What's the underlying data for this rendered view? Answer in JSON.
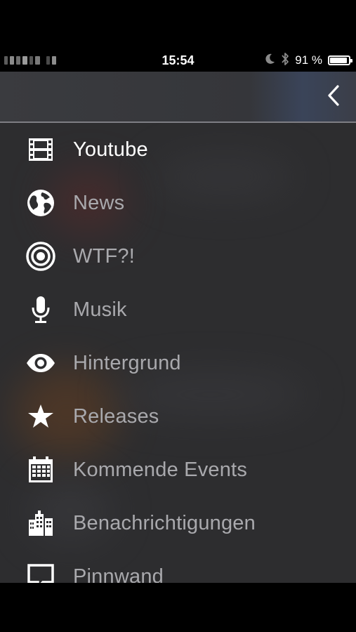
{
  "status_bar": {
    "time": "15:54",
    "battery_percent": "91 %",
    "battery_level": 0.91
  },
  "header": {
    "back_icon": "chevron-left-icon"
  },
  "menu": {
    "items": [
      {
        "label": "Youtube",
        "icon": "film-icon",
        "active": true
      },
      {
        "label": "News",
        "icon": "globe-icon",
        "active": false
      },
      {
        "label": "WTF?!",
        "icon": "target-icon",
        "active": false
      },
      {
        "label": "Musik",
        "icon": "microphone-icon",
        "active": false
      },
      {
        "label": "Hintergrund",
        "icon": "eye-icon",
        "active": false
      },
      {
        "label": "Releases",
        "icon": "star-icon",
        "active": false
      },
      {
        "label": "Kommende Events",
        "icon": "calendar-icon",
        "active": false
      },
      {
        "label": "Benachrichtigungen",
        "icon": "buildings-icon",
        "active": false
      },
      {
        "label": "Pinnwand",
        "icon": "speech-bubble-icon",
        "active": false
      }
    ]
  },
  "colors": {
    "panel_bg": "#2d2d2f",
    "label_inactive": "#a9a9ad",
    "label_active": "#ffffff",
    "divider": "#7e7e84"
  }
}
